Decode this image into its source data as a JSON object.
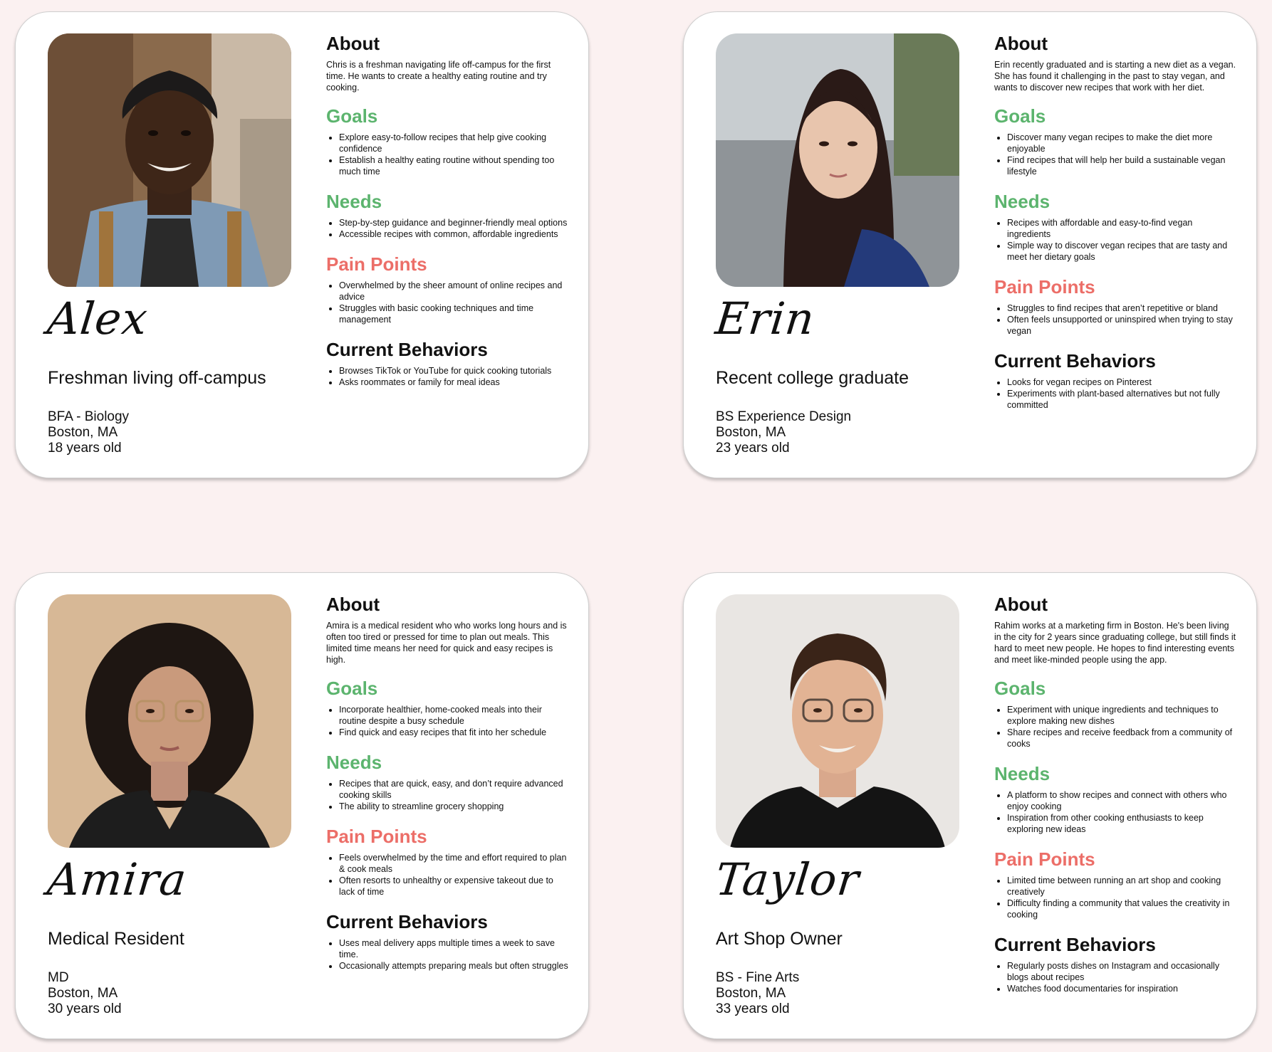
{
  "section_labels": {
    "about": "About",
    "goals": "Goals",
    "needs": "Needs",
    "pain_points": "Pain Points",
    "current_behaviors": "Current Behaviors"
  },
  "colors": {
    "goals_needs": "#5cb46e",
    "pain_points": "#ec6e68",
    "background": "#fbf1f1"
  },
  "personas": [
    {
      "name": "Alex",
      "role": "Freshman living off-campus",
      "degree": "BFA - Biology",
      "location": "Boston, MA",
      "age": "18 years old",
      "about": "Chris is a freshman navigating life off-campus for the first time. He wants to create a healthy eating routine and try cooking.",
      "goals": [
        "Explore easy-to-follow recipes that help give cooking confidence",
        "Establish a healthy eating routine without spending too much time"
      ],
      "needs": [
        "Step-by-step guidance and beginner-friendly meal options",
        "Accessible recipes with common, affordable ingredients"
      ],
      "pain_points": [
        "Overwhelmed by the sheer amount of online recipes and advice",
        "Struggles with basic cooking techniques and time management"
      ],
      "behaviors": [
        "Browses TikTok or YouTube for quick cooking tutorials",
        "Asks roommates or family for meal ideas"
      ]
    },
    {
      "name": "Erin",
      "role": "Recent college graduate",
      "degree": "BS Experience Design",
      "location": "Boston, MA",
      "age": "23 years old",
      "about": "Erin recently graduated and is starting a new diet as a vegan. She has found it challenging in the past to stay vegan, and wants to discover new recipes that work with her diet.",
      "goals": [
        "Discover many vegan recipes to make the diet more enjoyable",
        "Find recipes that will help her build a sustainable vegan lifestyle"
      ],
      "needs": [
        "Recipes with affordable and easy-to-find vegan ingredients",
        "Simple way to discover vegan recipes that are tasty and meet her dietary goals"
      ],
      "pain_points": [
        "Struggles to find recipes that aren’t repetitive or bland",
        "Often feels unsupported or uninspired when trying to stay vegan"
      ],
      "behaviors": [
        "Looks for vegan recipes on Pinterest",
        "Experiments with plant-based alternatives but not fully committed"
      ]
    },
    {
      "name": "Amira",
      "role": "Medical Resident",
      "degree": "MD",
      "location": "Boston, MA",
      "age": "30 years old",
      "about": "Amira is a medical resident who who works long hours and is often too tired or pressed for time to plan out meals. This limited time means her need for quick and easy recipes is high.",
      "goals": [
        "Incorporate healthier, home-cooked meals into their routine despite a busy schedule",
        "Find quick and easy recipes that fit into her schedule"
      ],
      "needs": [
        "Recipes that are quick, easy, and don’t require advanced cooking skills",
        "The ability to streamline grocery shopping"
      ],
      "pain_points": [
        "Feels overwhelmed by the time and effort required to plan & cook meals",
        "Often resorts to unhealthy or expensive takeout due to lack of time"
      ],
      "behaviors": [
        "Uses meal delivery apps multiple times a week to save time.",
        "Occasionally attempts preparing meals but often struggles"
      ]
    },
    {
      "name": "Taylor",
      "role": "Art Shop Owner",
      "degree": "BS - Fine Arts",
      "location": "Boston, MA",
      "age": "33 years old",
      "about": "Rahim works at a marketing firm in Boston. He's been living in the city for 2 years since graduating college, but still finds it hard to meet new people. He hopes to find interesting events and meet like-minded people using the app.",
      "goals": [
        "Experiment with unique ingredients and techniques to explore making new dishes",
        "Share recipes and receive feedback from a community of cooks"
      ],
      "needs": [
        "A platform to show recipes and connect with others who enjoy cooking",
        "Inspiration from other cooking enthusiasts to keep exploring new ideas"
      ],
      "pain_points": [
        "Limited time between running an art shop and cooking creatively",
        "Difficulty finding a community that values the creativity in cooking"
      ],
      "behaviors": [
        "Regularly posts dishes on Instagram and occasionally blogs about recipes",
        "Watches food documentaries for inspiration"
      ]
    }
  ]
}
